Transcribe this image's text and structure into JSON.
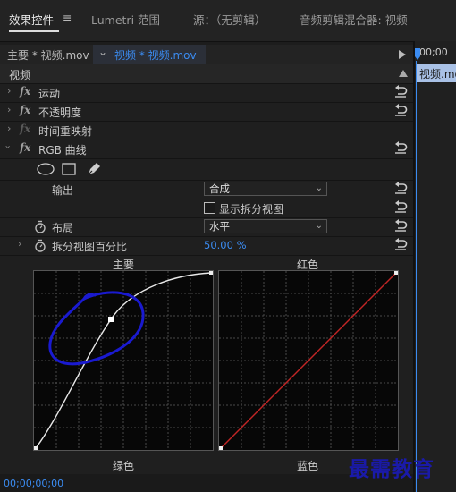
{
  "tabs": [
    {
      "label": "效果控件"
    },
    {
      "label": "Lumetri 范围"
    },
    {
      "label": "源：（无剪辑）"
    },
    {
      "label": "音频剪辑混合器: 视频"
    }
  ],
  "tab_menu_icon": "≡",
  "source_row": {
    "master_clip": "主要 * 视频.mov",
    "chevron": "⌄",
    "active_clip": "视频 * 视频.mov"
  },
  "section_label": "视频",
  "effects": [
    {
      "label": "运动",
      "fx": "fx"
    },
    {
      "label": "不透明度",
      "fx": "fx"
    },
    {
      "label": "时间重映射",
      "fx": "fx"
    },
    {
      "label": "RGB 曲线",
      "fx": "fx"
    }
  ],
  "output": {
    "label": "输出",
    "value": "合成"
  },
  "split_view": {
    "label": "显示拆分视图"
  },
  "layout": {
    "label": "布局",
    "value": "水平"
  },
  "split_percent": {
    "label": "拆分视图百分比",
    "value": "50.00 %"
  },
  "curves": [
    {
      "label": "主要"
    },
    {
      "label": "红色"
    },
    {
      "label": "绿色"
    },
    {
      "label": "蓝色"
    }
  ],
  "timeline": {
    "timecode_top": "00;00",
    "clip_label": "视频.mo"
  },
  "bottom_timecode": "00;00;00;00",
  "watermark": "最需教育",
  "colors": {
    "accent_blue": "#3b8cf2",
    "red_curve": "#c42525",
    "annotation": "#1a1ad0"
  },
  "icons": [
    "tab-menu-icon",
    "twirl-icon",
    "fx-icon",
    "reset-icon",
    "ellipse-mask-icon",
    "rectangle-mask-icon",
    "pen-mask-icon",
    "stopwatch-icon",
    "checkbox-icon",
    "chevron-down-icon",
    "playhead-icon"
  ]
}
